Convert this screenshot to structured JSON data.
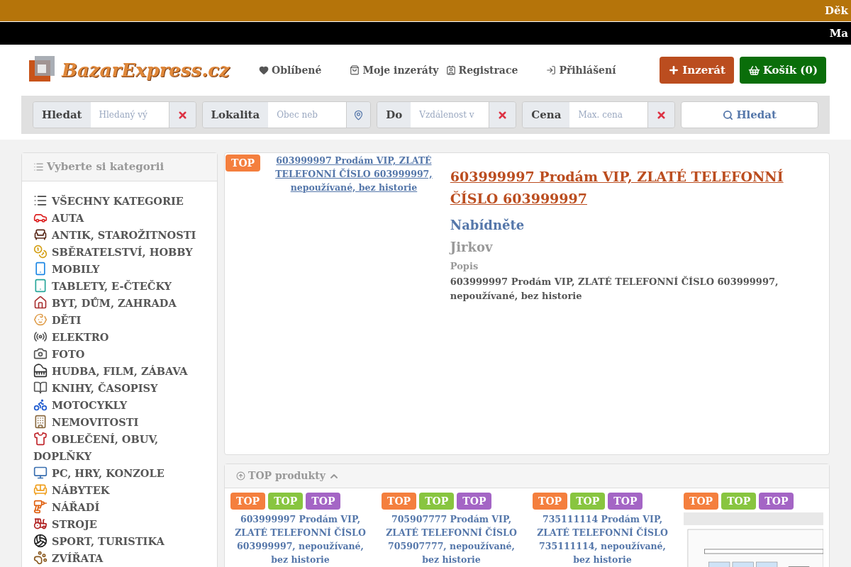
{
  "banners": [
    {
      "text": "Děk"
    },
    {
      "text": "Ma"
    }
  ],
  "header": {
    "logo": "BazarExpress.cz",
    "nav": [
      "Oblíbené",
      "Moje inzeráty",
      "Registrace",
      "Přihlášení"
    ],
    "add_button": "Inzerát",
    "cart_button": "Košík (0)"
  },
  "search": {
    "fields": [
      {
        "label": "Hledat",
        "placeholder": "Hledaný vý",
        "kind": "clear"
      },
      {
        "label": "Lokalita",
        "placeholder": "Obec neb",
        "kind": "location"
      },
      {
        "label": "Do",
        "placeholder": "Vzdálenost v",
        "kind": "clear"
      },
      {
        "label": "Cena",
        "placeholder": "Max. cena",
        "kind": "clear"
      }
    ],
    "button": "Hledat"
  },
  "sidebar": {
    "title": "Vyberte si kategorii",
    "items": [
      "VŠECHNY KATEGORIE",
      "AUTA",
      "ANTIK, STAROŽITNOSTI",
      "SBĚRATELSTVÍ, HOBBY",
      "MOBILY",
      "TABLETY, E-ČTEČKY",
      "BYT, DŮM, ZAHRADA",
      "DĚTI",
      "ELEKTRO",
      "FOTO",
      "HUDBA, FILM, ZÁBAVA",
      "KNIHY, ČASOPISY",
      "MOTOCYKLY",
      "NEMOVITOSTI",
      "OBLEČENÍ, OBUV, DOPLŇKY",
      "PC, HRY, KONZOLE",
      "NÁBYTEK",
      "NÁŘADÍ",
      "STROJE",
      "SPORT, TURISTIKA",
      "ZVÍŘATA"
    ]
  },
  "featured": {
    "badge": "TOP",
    "image_link": "603999997 Prodám VIP, ZLATÉ TELEFONNÍ ČÍSLO 603999997, nepoužívané, bez historie",
    "title": "603999997 Prodám VIP, ZLATÉ TELEFONNÍ ČÍSLO 603999997",
    "price": "Nabídněte",
    "location": "Jirkov",
    "description_label": "Popis",
    "description": "603999997 Prodám VIP, ZLATÉ TELEFONNÍ ČÍSLO 603999997, nepoužívané, bez historie"
  },
  "top_products": {
    "title": "TOP produkty",
    "items": [
      {
        "badges": [
          {
            "text": "TOP",
            "color": "#f47f3e"
          },
          {
            "text": "TOP",
            "color": "#88c540"
          },
          {
            "text": "TOP",
            "color": "#a465c5"
          }
        ],
        "title": "603999997 Prodám VIP, ZLATÉ TELEFONNÍ ČÍSLO 603999997, nepoužívané, bez historie",
        "kind": "text"
      },
      {
        "badges": [
          {
            "text": "TOP",
            "color": "#f47f3e"
          },
          {
            "text": "TOP",
            "color": "#88c540"
          },
          {
            "text": "TOP",
            "color": "#a465c5"
          }
        ],
        "title": "705907777 Prodám VIP, ZLATÉ TELEFONNÍ ČÍSLO 705907777, nepoužívané, bez historie",
        "kind": "text"
      },
      {
        "badges": [
          {
            "text": "TOP",
            "color": "#f47f3e"
          },
          {
            "text": "TOP",
            "color": "#88c540"
          },
          {
            "text": "TOP",
            "color": "#a465c5"
          }
        ],
        "title": "735111114 Prodám VIP, ZLATÉ TELEFONNÍ ČÍSLO 735111114, nepoužívané, bez historie",
        "kind": "text"
      },
      {
        "badges": [
          {
            "text": "TOP",
            "color": "#f47f3e"
          },
          {
            "text": "TOP",
            "color": "#88c540"
          },
          {
            "text": "TOP",
            "color": "#a465c5"
          }
        ],
        "kind": "picture"
      }
    ]
  }
}
